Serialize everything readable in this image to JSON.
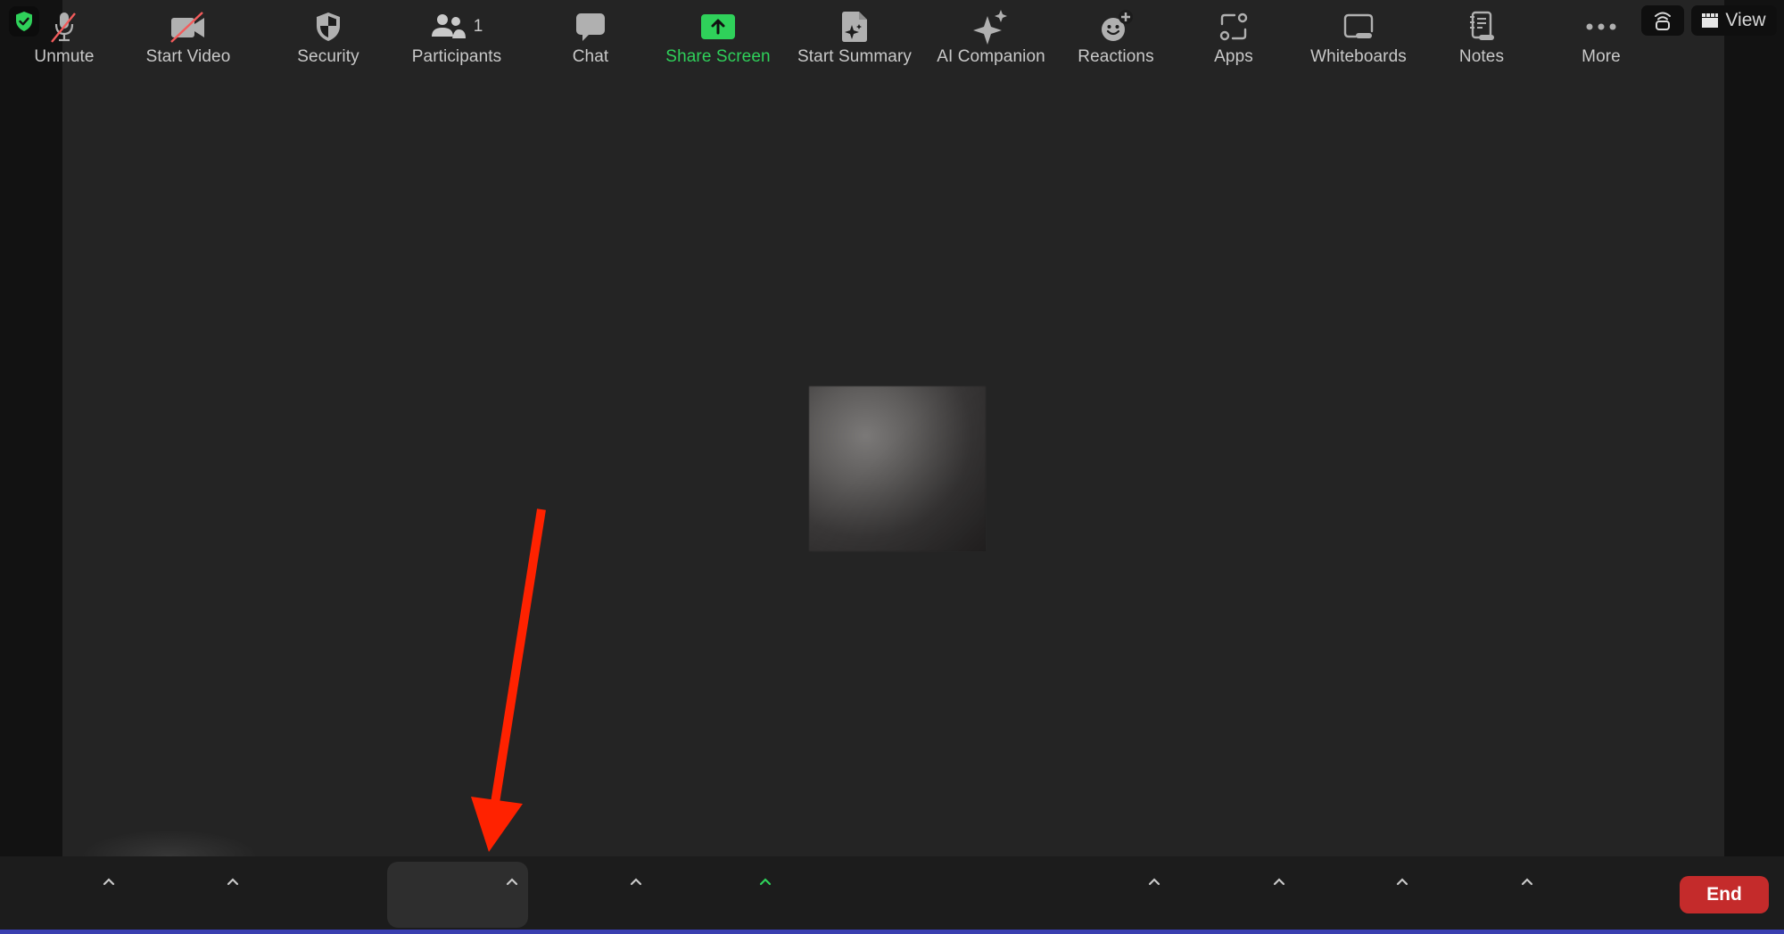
{
  "window": {
    "security_badge_icon": "shield-check-icon",
    "security_badge_color": "#2fd15a"
  },
  "top_controls": {
    "audio_icon": "audio-connection-icon",
    "view_label": "View",
    "view_icon": "gallery-grid-icon"
  },
  "video_area": {
    "participant_avatar": "blurred-profile-image"
  },
  "annotation": {
    "arrow_color": "#ff2200",
    "points_to": "Participants"
  },
  "toolbar": {
    "items": [
      {
        "label": "Unmute",
        "icon": "microphone-muted-icon",
        "has_caret": true
      },
      {
        "label": "Start Video",
        "icon": "video-off-icon",
        "has_caret": true
      },
      {
        "label": "Security",
        "icon": "shield-icon",
        "has_caret": false
      },
      {
        "label": "Participants",
        "icon": "participants-icon",
        "count": "1",
        "has_caret": true,
        "active": true
      },
      {
        "label": "Chat",
        "icon": "chat-bubble-icon",
        "has_caret": true
      },
      {
        "label": "Share Screen",
        "icon": "share-screen-icon",
        "has_caret": true,
        "color": "#2fd15a"
      },
      {
        "label": "Start Summary",
        "icon": "summary-document-icon",
        "has_caret": false
      },
      {
        "label": "AI Companion",
        "icon": "sparkle-icon",
        "has_caret": false
      },
      {
        "label": "Reactions",
        "icon": "emoji-add-icon",
        "has_caret": true
      },
      {
        "label": "Apps",
        "icon": "apps-icon",
        "has_caret": true
      },
      {
        "label": "Whiteboards",
        "icon": "whiteboard-icon",
        "has_caret": true
      },
      {
        "label": "Notes",
        "icon": "notes-icon",
        "has_caret": true
      },
      {
        "label": "More",
        "icon": "more-dots-icon",
        "has_caret": false
      }
    ],
    "end_label": "End",
    "end_color": "#c42b2b"
  }
}
